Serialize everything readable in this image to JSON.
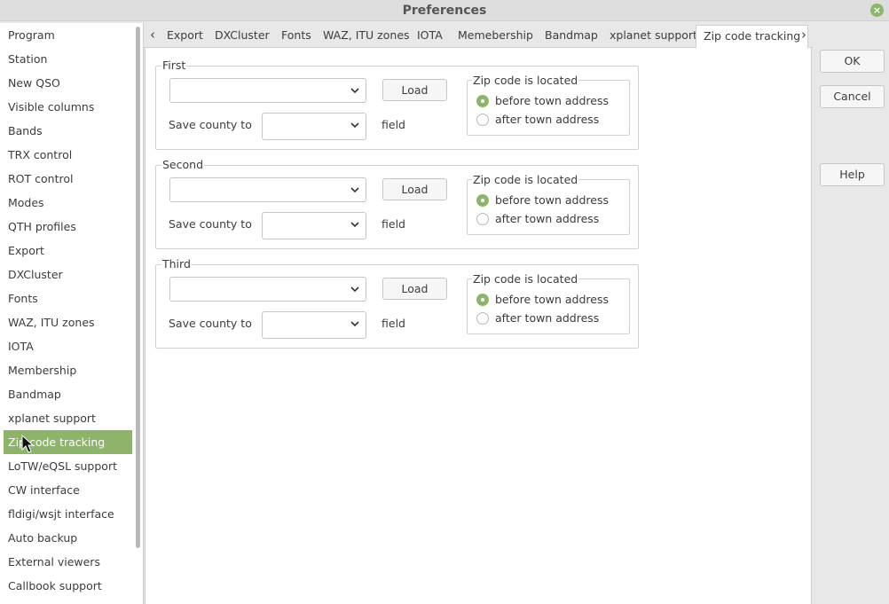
{
  "window": {
    "title": "Preferences"
  },
  "sidebar": {
    "items": [
      "Program",
      "Station",
      "New QSO",
      "Visible columns",
      "Bands",
      "TRX control",
      "ROT control",
      "Modes",
      "QTH profiles",
      "Export",
      "DXCluster",
      "Fonts",
      "WAZ, ITU zones",
      "IOTA",
      "Membership",
      "Bandmap",
      "xplanet support",
      "Zip code tracking",
      "LoTW/eQSL support",
      "CW interface",
      "fldigi/wsjt interface",
      "Auto backup",
      "External viewers",
      "Callbook support"
    ],
    "selected": "Zip code tracking"
  },
  "tabs": {
    "items": [
      "Export",
      "DXCluster",
      "Fonts",
      "WAZ, ITU zones",
      "IOTA",
      "Memebership",
      "Bandmap",
      "xplanet support",
      "Zip code tracking"
    ],
    "active": "Zip code tracking",
    "prev_arrow": "‹",
    "next_arrow": "›"
  },
  "groups": [
    {
      "title": "First",
      "file_value": "",
      "load_label": "Load",
      "save_county_label": "Save county to",
      "field_value": "",
      "field_label": "field",
      "location_title": "Zip code is located",
      "option_before": "before town address",
      "option_after": "after town address",
      "selected_option": "before"
    },
    {
      "title": "Second",
      "file_value": "",
      "load_label": "Load",
      "save_county_label": "Save county to",
      "field_value": "",
      "field_label": "field",
      "location_title": "Zip code is located",
      "option_before": "before town address",
      "option_after": "after town address",
      "selected_option": "before"
    },
    {
      "title": "Third",
      "file_value": "",
      "load_label": "Load",
      "save_county_label": "Save county to",
      "field_value": "",
      "field_label": "field",
      "location_title": "Zip code is located",
      "option_before": "before town address",
      "option_after": "after town address",
      "selected_option": "before"
    }
  ],
  "buttons": {
    "ok": "OK",
    "cancel": "Cancel",
    "help": "Help"
  },
  "colors": {
    "accent": "#8eb36a",
    "close": "#8cb76b"
  }
}
